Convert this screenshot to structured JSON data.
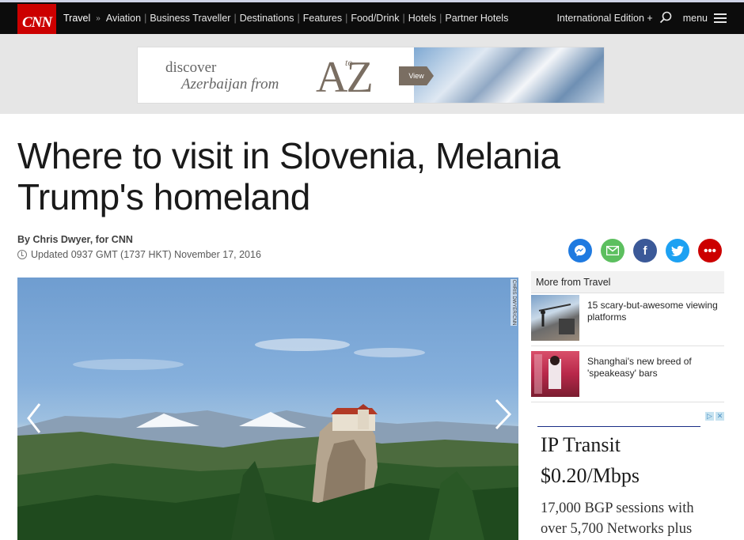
{
  "header": {
    "logo": "CNN",
    "section": "Travel",
    "nav_items": [
      "Aviation",
      "Business Traveller",
      "Destinations",
      "Features",
      "Food/Drink",
      "Hotels",
      "Partner Hotels"
    ],
    "edition": "International Edition +",
    "menu": "menu"
  },
  "banner_ad": {
    "line1": "discover",
    "line2": "Azerbaijan from",
    "big": "AZ",
    "to": "to",
    "tag": "View"
  },
  "article": {
    "headline": "Where to visit in Slovenia, Melania Trump's homeland",
    "byline": "By Chris Dwyer, for CNN",
    "updated": "Updated 0937 GMT (1737 HKT) November 17, 2016",
    "photo_credit": "CHRIS DWYER/CNN"
  },
  "share": {
    "colors": {
      "messenger": "#1f7ae0",
      "email": "#5cbf5f",
      "facebook": "#3b5998",
      "twitter": "#1da1f2",
      "more": "#cc0000"
    }
  },
  "sidebar": {
    "title": "More from Travel",
    "items": [
      {
        "label": "15 scary-but-awesome viewing platforms"
      },
      {
        "label": "Shanghai's new breed of 'speakeasy' bars"
      }
    ]
  },
  "side_ad": {
    "line1": "IP Transit",
    "line2": "$0.20/Mbps",
    "body": "17,000 BGP sessions with over 5,700 Networks plus"
  },
  "colors": {
    "cnn_red": "#cc0000",
    "topbar": "#0c0c0c"
  }
}
